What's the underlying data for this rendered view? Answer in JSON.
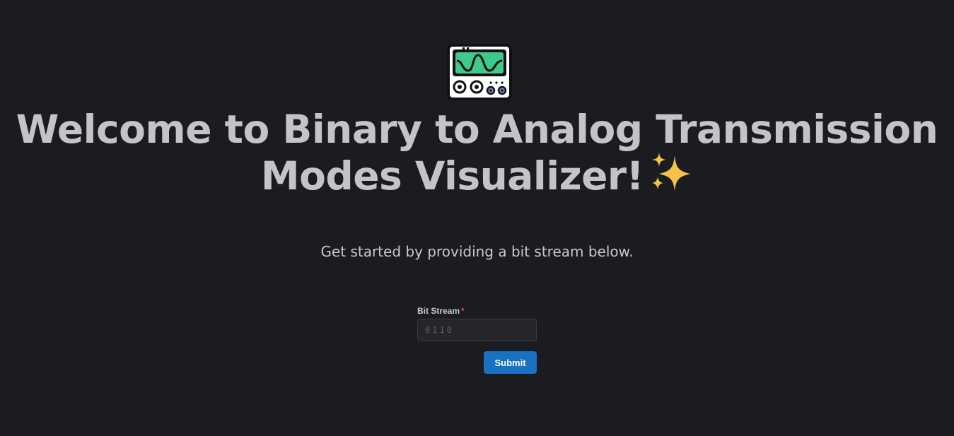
{
  "header": {
    "title_line1": "Welcome to Binary to Analog Transmission",
    "title_line2": "Modes Visualizer!",
    "subtitle": "Get started by providing a bit stream below."
  },
  "icons": {
    "logo": "oscilloscope-icon",
    "title_decoration": "sparkles-icon"
  },
  "form": {
    "bit_stream_label": "Bit Stream",
    "required_marker": "*",
    "bit_stream_placeholder": "0110",
    "bit_stream_value": "",
    "submit_label": "Submit"
  },
  "colors": {
    "background": "#1b1c20",
    "text": "#c3c4c8",
    "accent": "#1971c2",
    "required": "#e5484d",
    "logo_screen": "#3fc98a"
  }
}
